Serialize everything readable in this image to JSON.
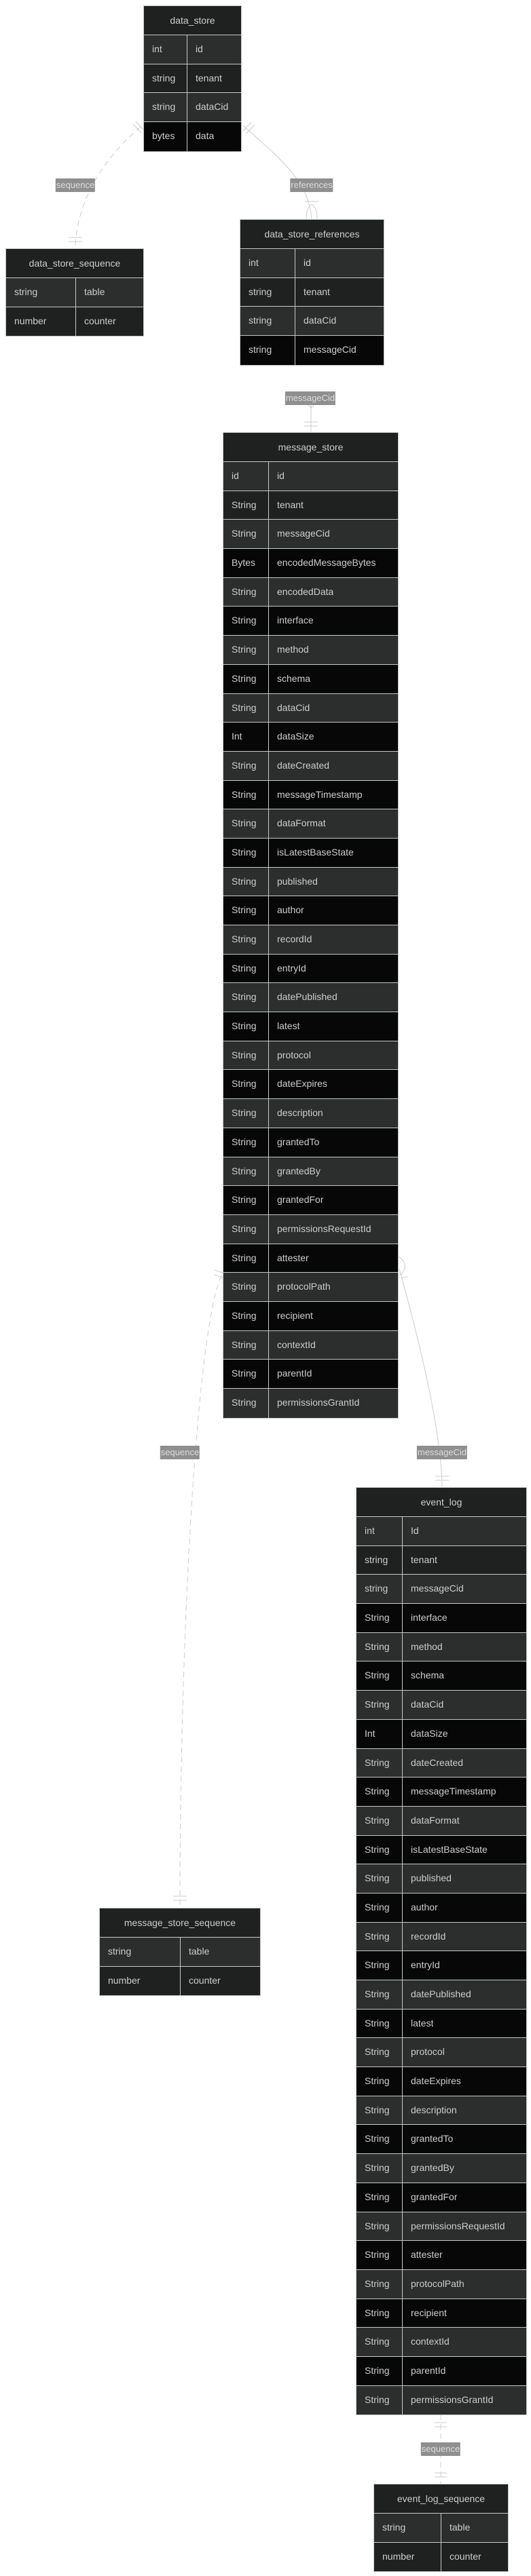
{
  "colors": {
    "header_bg": "#1f2020",
    "row_gray": "#2c2d2d",
    "row_dark": "#1f2020",
    "row_black": "#070707",
    "border": "#c8c8c8",
    "edge": "#cccccc",
    "label_bg": "#8f8f8f"
  },
  "entities": [
    {
      "id": "data_store",
      "name": "data_store",
      "attributes": [
        {
          "type": "int",
          "name": "id"
        },
        {
          "type": "string",
          "name": "tenant"
        },
        {
          "type": "string",
          "name": "dataCid"
        },
        {
          "type": "bytes",
          "name": "data"
        }
      ]
    },
    {
      "id": "data_store_sequence",
      "name": "data_store_sequence",
      "attributes": [
        {
          "type": "string",
          "name": "table"
        },
        {
          "type": "number",
          "name": "counter"
        }
      ]
    },
    {
      "id": "data_store_references",
      "name": "data_store_references",
      "attributes": [
        {
          "type": "int",
          "name": "id"
        },
        {
          "type": "string",
          "name": "tenant"
        },
        {
          "type": "string",
          "name": "dataCid"
        },
        {
          "type": "string",
          "name": "messageCid"
        }
      ]
    },
    {
      "id": "message_store",
      "name": "message_store",
      "attributes": [
        {
          "type": "id",
          "name": "id"
        },
        {
          "type": "String",
          "name": "tenant"
        },
        {
          "type": "String",
          "name": "messageCid"
        },
        {
          "type": "Bytes",
          "name": "encodedMessageBytes"
        },
        {
          "type": "String",
          "name": "encodedData"
        },
        {
          "type": "String",
          "name": "interface"
        },
        {
          "type": "String",
          "name": "method"
        },
        {
          "type": "String",
          "name": "schema"
        },
        {
          "type": "String",
          "name": "dataCid"
        },
        {
          "type": "Int",
          "name": "dataSize"
        },
        {
          "type": "String",
          "name": "dateCreated"
        },
        {
          "type": "String",
          "name": "messageTimestamp"
        },
        {
          "type": "String",
          "name": "dataFormat"
        },
        {
          "type": "String",
          "name": "isLatestBaseState"
        },
        {
          "type": "String",
          "name": "published"
        },
        {
          "type": "String",
          "name": "author"
        },
        {
          "type": "String",
          "name": "recordId"
        },
        {
          "type": "String",
          "name": "entryId"
        },
        {
          "type": "String",
          "name": "datePublished"
        },
        {
          "type": "String",
          "name": "latest"
        },
        {
          "type": "String",
          "name": "protocol"
        },
        {
          "type": "String",
          "name": "dateExpires"
        },
        {
          "type": "String",
          "name": "description"
        },
        {
          "type": "String",
          "name": "grantedTo"
        },
        {
          "type": "String",
          "name": "grantedBy"
        },
        {
          "type": "String",
          "name": "grantedFor"
        },
        {
          "type": "String",
          "name": "permissionsRequestId"
        },
        {
          "type": "String",
          "name": "attester"
        },
        {
          "type": "String",
          "name": "protocolPath"
        },
        {
          "type": "String",
          "name": "recipient"
        },
        {
          "type": "String",
          "name": "contextId"
        },
        {
          "type": "String",
          "name": "parentId"
        },
        {
          "type": "String",
          "name": "permissionsGrantId"
        }
      ]
    },
    {
      "id": "message_store_sequence",
      "name": "message_store_sequence",
      "attributes": [
        {
          "type": "string",
          "name": "table"
        },
        {
          "type": "number",
          "name": "counter"
        }
      ]
    },
    {
      "id": "event_log",
      "name": "event_log",
      "attributes": [
        {
          "type": "int",
          "name": "Id"
        },
        {
          "type": "string",
          "name": "tenant"
        },
        {
          "type": "string",
          "name": "messageCid"
        },
        {
          "type": "String",
          "name": "interface"
        },
        {
          "type": "String",
          "name": "method"
        },
        {
          "type": "String",
          "name": "schema"
        },
        {
          "type": "String",
          "name": "dataCid"
        },
        {
          "type": "Int",
          "name": "dataSize"
        },
        {
          "type": "String",
          "name": "dateCreated"
        },
        {
          "type": "String",
          "name": "messageTimestamp"
        },
        {
          "type": "String",
          "name": "dataFormat"
        },
        {
          "type": "String",
          "name": "isLatestBaseState"
        },
        {
          "type": "String",
          "name": "published"
        },
        {
          "type": "String",
          "name": "author"
        },
        {
          "type": "String",
          "name": "recordId"
        },
        {
          "type": "String",
          "name": "entryId"
        },
        {
          "type": "String",
          "name": "datePublished"
        },
        {
          "type": "String",
          "name": "latest"
        },
        {
          "type": "String",
          "name": "protocol"
        },
        {
          "type": "String",
          "name": "dateExpires"
        },
        {
          "type": "String",
          "name": "description"
        },
        {
          "type": "String",
          "name": "grantedTo"
        },
        {
          "type": "String",
          "name": "grantedBy"
        },
        {
          "type": "String",
          "name": "grantedFor"
        },
        {
          "type": "String",
          "name": "permissionsRequestId"
        },
        {
          "type": "String",
          "name": "attester"
        },
        {
          "type": "String",
          "name": "protocolPath"
        },
        {
          "type": "String",
          "name": "recipient"
        },
        {
          "type": "String",
          "name": "contextId"
        },
        {
          "type": "String",
          "name": "parentId"
        },
        {
          "type": "String",
          "name": "permissionsGrantId"
        }
      ]
    },
    {
      "id": "event_log_sequence",
      "name": "event_log_sequence",
      "attributes": [
        {
          "type": "string",
          "name": "table"
        },
        {
          "type": "number",
          "name": "counter"
        }
      ]
    }
  ],
  "relationships": [
    {
      "from": "data_store",
      "to": "data_store_sequence",
      "label": "sequence",
      "style": "dashed",
      "cardinality": "exactly-one to exactly-one"
    },
    {
      "from": "data_store",
      "to": "data_store_references",
      "label": "references",
      "style": "solid",
      "cardinality": "exactly-one to one-or-more"
    },
    {
      "from": "data_store_references",
      "to": "message_store",
      "label": "messageCid",
      "style": "solid",
      "cardinality": "one-or-more to exactly-one"
    },
    {
      "from": "message_store",
      "to": "message_store_sequence",
      "label": "sequence",
      "style": "dashed",
      "cardinality": "exactly-one to exactly-one"
    },
    {
      "from": "message_store",
      "to": "event_log",
      "label": "messageCid",
      "style": "solid",
      "cardinality": "one-or-more to exactly-one"
    },
    {
      "from": "event_log",
      "to": "event_log_sequence",
      "label": "sequence",
      "style": "dashed",
      "cardinality": "exactly-one to exactly-one"
    }
  ]
}
